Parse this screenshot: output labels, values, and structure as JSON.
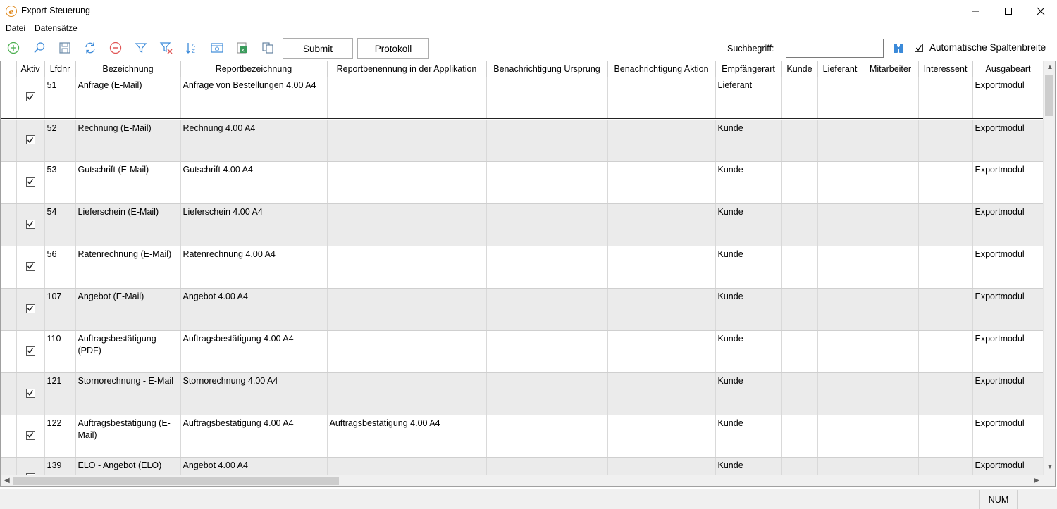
{
  "window": {
    "title": "Export-Steuerung"
  },
  "menu": {
    "items": [
      "Datei",
      "Datensätze"
    ]
  },
  "toolbar": {
    "icons": [
      "add-icon",
      "search-icon",
      "save-icon",
      "refresh-icon",
      "delete-icon",
      "filter-icon",
      "clear-filter-icon",
      "sort-icon",
      "view-icon",
      "excel-export-icon",
      "copy-icon"
    ],
    "submit_label": "Submit",
    "protokoll_label": "Protokoll",
    "search_label": "Suchbegriff:",
    "search_value": "",
    "auto_width_label": "Automatische Spaltenbreite",
    "auto_width_checked": true
  },
  "grid": {
    "columns": [
      "Aktiv",
      "Lfdnr",
      "Bezeichnung",
      "Reportbezeichnung",
      "Reportbenennung in der Applikation",
      "Benachrichtigung Ursprung",
      "Benachrichtigung Aktion",
      "Empfängerart",
      "Kunde",
      "Lieferant",
      "Mitarbeiter",
      "Interessent",
      "Ausgabeart"
    ],
    "rows": [
      {
        "aktiv": true,
        "lfdnr": "51",
        "bezeichnung": "Anfrage (E-Mail)",
        "reportbezeichnung": "Anfrage von Bestellungen 4.00 A4",
        "reportbenennung": "",
        "ursprung": "",
        "aktion": "",
        "empfaengerart": "Lieferant",
        "kunde": "",
        "lieferant": "",
        "mitarbeiter": "",
        "interessent": "",
        "ausgabeart": "Exportmodul"
      },
      {
        "aktiv": true,
        "lfdnr": "52",
        "bezeichnung": "Rechnung (E-Mail)",
        "reportbezeichnung": "Rechnung 4.00 A4",
        "reportbenennung": "",
        "ursprung": "",
        "aktion": "",
        "empfaengerart": "Kunde",
        "kunde": "",
        "lieferant": "",
        "mitarbeiter": "",
        "interessent": "",
        "ausgabeart": "Exportmodul"
      },
      {
        "aktiv": true,
        "lfdnr": "53",
        "bezeichnung": "Gutschrift (E-Mail)",
        "reportbezeichnung": "Gutschrift 4.00 A4",
        "reportbenennung": "",
        "ursprung": "",
        "aktion": "",
        "empfaengerart": "Kunde",
        "kunde": "",
        "lieferant": "",
        "mitarbeiter": "",
        "interessent": "",
        "ausgabeart": "Exportmodul"
      },
      {
        "aktiv": true,
        "lfdnr": "54",
        "bezeichnung": "Lieferschein (E-Mail)",
        "reportbezeichnung": "Lieferschein 4.00 A4",
        "reportbenennung": "",
        "ursprung": "",
        "aktion": "",
        "empfaengerart": "Kunde",
        "kunde": "",
        "lieferant": "",
        "mitarbeiter": "",
        "interessent": "",
        "ausgabeart": "Exportmodul"
      },
      {
        "aktiv": true,
        "lfdnr": "56",
        "bezeichnung": "Ratenrechnung (E-Mail)",
        "reportbezeichnung": "Ratenrechnung 4.00 A4",
        "reportbenennung": "",
        "ursprung": "",
        "aktion": "",
        "empfaengerart": "Kunde",
        "kunde": "",
        "lieferant": "",
        "mitarbeiter": "",
        "interessent": "",
        "ausgabeart": "Exportmodul"
      },
      {
        "aktiv": true,
        "lfdnr": "107",
        "bezeichnung": "Angebot  (E-Mail)",
        "reportbezeichnung": "Angebot 4.00 A4",
        "reportbenennung": "",
        "ursprung": "",
        "aktion": "",
        "empfaengerart": "Kunde",
        "kunde": "",
        "lieferant": "",
        "mitarbeiter": "",
        "interessent": "",
        "ausgabeart": "Exportmodul"
      },
      {
        "aktiv": true,
        "lfdnr": "110",
        "bezeichnung": "Auftragsbestätigung (PDF)",
        "reportbezeichnung": "Auftragsbestätigung 4.00 A4",
        "reportbenennung": "",
        "ursprung": "",
        "aktion": "",
        "empfaengerart": "Kunde",
        "kunde": "",
        "lieferant": "",
        "mitarbeiter": "",
        "interessent": "",
        "ausgabeart": "Exportmodul"
      },
      {
        "aktiv": true,
        "lfdnr": "121",
        "bezeichnung": "Stornorechnung - E-Mail",
        "reportbezeichnung": "Stornorechnung 4.00 A4",
        "reportbenennung": "",
        "ursprung": "",
        "aktion": "",
        "empfaengerart": "Kunde",
        "kunde": "",
        "lieferant": "",
        "mitarbeiter": "",
        "interessent": "",
        "ausgabeart": "Exportmodul"
      },
      {
        "aktiv": true,
        "lfdnr": "122",
        "bezeichnung": "Auftragsbestätigung (E-Mail)",
        "reportbezeichnung": "Auftragsbestätigung 4.00 A4",
        "reportbenennung": "Auftragsbestätigung 4.00 A4",
        "ursprung": "",
        "aktion": "",
        "empfaengerart": "Kunde",
        "kunde": "",
        "lieferant": "",
        "mitarbeiter": "",
        "interessent": "",
        "ausgabeart": "Exportmodul"
      },
      {
        "aktiv": true,
        "lfdnr": "139",
        "bezeichnung": "ELO - Angebot (ELO)",
        "reportbezeichnung": "Angebot 4.00 A4",
        "reportbenennung": "",
        "ursprung": "",
        "aktion": "",
        "empfaengerart": "Kunde",
        "kunde": "",
        "lieferant": "",
        "mitarbeiter": "",
        "interessent": "",
        "ausgabeart": "Exportmodul"
      }
    ]
  },
  "status": {
    "num": "NUM"
  }
}
